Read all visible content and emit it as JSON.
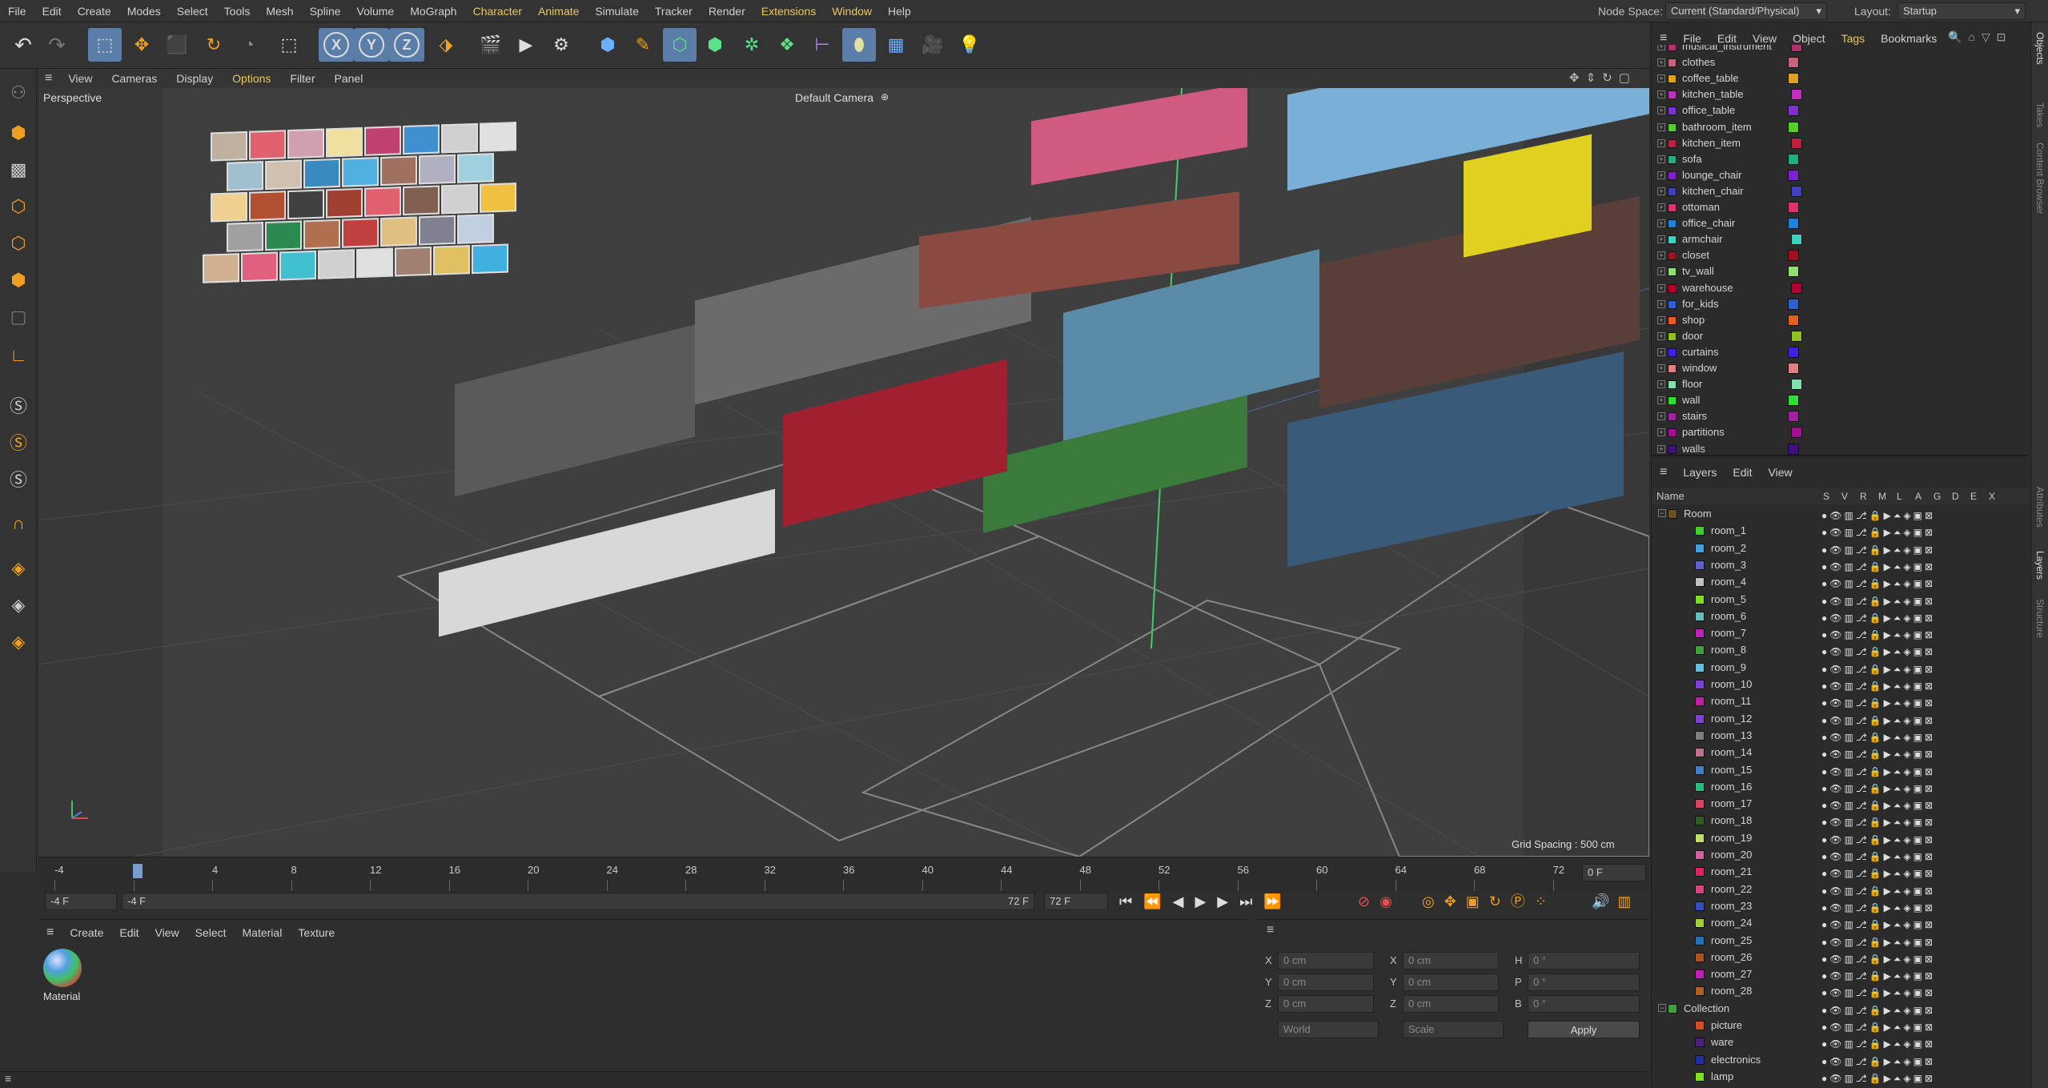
{
  "menubar": {
    "items": [
      "File",
      "Edit",
      "Create",
      "Modes",
      "Select",
      "Tools",
      "Mesh",
      "Spline",
      "Volume",
      "MoGraph",
      "Character",
      "Animate",
      "Simulate",
      "Tracker",
      "Render",
      "Extensions",
      "Window",
      "Help"
    ],
    "node_space_label": "Node Space:",
    "node_space_value": "Current (Standard/Physical)",
    "layout_label": "Layout:",
    "layout_value": "Startup"
  },
  "toolbar": {
    "axis_x": "X",
    "axis_y": "Y",
    "axis_z": "Z"
  },
  "viewport": {
    "menu": [
      "View",
      "Cameras",
      "Display",
      "Options",
      "Filter",
      "Panel"
    ],
    "view_name": "Perspective",
    "camera": "Default Camera",
    "grid_spacing": "Grid Spacing : 500 cm"
  },
  "timeline": {
    "ticks": [
      "-4",
      "0",
      "4",
      "8",
      "12",
      "16",
      "20",
      "24",
      "28",
      "32",
      "36",
      "40",
      "44",
      "48",
      "52",
      "56",
      "60",
      "64",
      "68",
      "72"
    ],
    "current_frame": "0 F",
    "start_field": "-4 F",
    "range_start": "-4 F",
    "range_end": "72 F",
    "end_field": "72 F"
  },
  "material_manager": {
    "menu": [
      "Create",
      "Edit",
      "View",
      "Select",
      "Material",
      "Texture"
    ],
    "material_name": "Material"
  },
  "attributes": {
    "x_label": "X",
    "y_label": "Y",
    "z_label": "Z",
    "h_label": "H",
    "p_label": "P",
    "b_label": "B",
    "pos_x": "0 cm",
    "pos_y": "0 cm",
    "pos_z": "0 cm",
    "size_x": "0 cm",
    "size_y": "0 cm",
    "size_z": "0 cm",
    "rot_h": "0 °",
    "rot_p": "0 °",
    "rot_b": "0 °",
    "coord_mode": "World",
    "size_mode": "Scale",
    "apply": "Apply"
  },
  "object_manager": {
    "menu": [
      "File",
      "Edit",
      "View",
      "Object",
      "Tags",
      "Bookmarks"
    ],
    "objects": [
      {
        "name": "musical_instrument",
        "color": "#b03070"
      },
      {
        "name": "clothes",
        "color": "#c86080"
      },
      {
        "name": "coffee_table",
        "color": "#e0a020"
      },
      {
        "name": "kitchen_table",
        "color": "#c030c0"
      },
      {
        "name": "office_table",
        "color": "#8030d0"
      },
      {
        "name": "bathroom_item",
        "color": "#50d020"
      },
      {
        "name": "kitchen_item",
        "color": "#c02040"
      },
      {
        "name": "sofa",
        "color": "#20b080"
      },
      {
        "name": "lounge_chair",
        "color": "#8020d0"
      },
      {
        "name": "kitchen_chair",
        "color": "#4040c0"
      },
      {
        "name": "ottoman",
        "color": "#e03070"
      },
      {
        "name": "office_chair",
        "color": "#2080e0"
      },
      {
        "name": "armchair",
        "color": "#40d0c0"
      },
      {
        "name": "closet",
        "color": "#a01020"
      },
      {
        "name": "tv_wall",
        "color": "#90e070"
      },
      {
        "name": "warehouse",
        "color": "#b00030"
      },
      {
        "name": "for_kids",
        "color": "#3060d0"
      },
      {
        "name": "shop",
        "color": "#e06020"
      },
      {
        "name": "door",
        "color": "#90c020"
      },
      {
        "name": "curtains",
        "color": "#4020e0"
      },
      {
        "name": "window",
        "color": "#e08080"
      },
      {
        "name": "floor",
        "color": "#80e0b0"
      },
      {
        "name": "wall",
        "color": "#30e030"
      },
      {
        "name": "stairs",
        "color": "#a020a0"
      },
      {
        "name": "partitions",
        "color": "#a01090"
      },
      {
        "name": "walls",
        "color": "#401080"
      }
    ]
  },
  "layers": {
    "menu": [
      "Layers",
      "Edit",
      "View"
    ],
    "col_name": "Name",
    "flag_headers": [
      "S",
      "V",
      "R",
      "M",
      "L",
      "A",
      "G",
      "D",
      "E",
      "X"
    ],
    "items": [
      {
        "name": "Room",
        "color": "#6a5020",
        "level": 0
      },
      {
        "name": "room_1",
        "color": "#40d020",
        "level": 1
      },
      {
        "name": "room_2",
        "color": "#40a0e0",
        "level": 1
      },
      {
        "name": "room_3",
        "color": "#6060d0",
        "level": 1
      },
      {
        "name": "room_4",
        "color": "#c0c0c0",
        "level": 1
      },
      {
        "name": "room_5",
        "color": "#80e020",
        "level": 1
      },
      {
        "name": "room_6",
        "color": "#60c0c0",
        "level": 1
      },
      {
        "name": "room_7",
        "color": "#c020c0",
        "level": 1
      },
      {
        "name": "room_8",
        "color": "#40a040",
        "level": 1
      },
      {
        "name": "room_9",
        "color": "#60c0e0",
        "level": 1
      },
      {
        "name": "room_10",
        "color": "#8040e0",
        "level": 1
      },
      {
        "name": "room_11",
        "color": "#c020a0",
        "level": 1
      },
      {
        "name": "room_12",
        "color": "#8040d0",
        "level": 1
      },
      {
        "name": "room_13",
        "color": "#808080",
        "level": 1
      },
      {
        "name": "room_14",
        "color": "#c07090",
        "level": 1
      },
      {
        "name": "room_15",
        "color": "#4080c0",
        "level": 1
      },
      {
        "name": "room_16",
        "color": "#20c080",
        "level": 1
      },
      {
        "name": "room_17",
        "color": "#e04060",
        "level": 1
      },
      {
        "name": "room_18",
        "color": "#306020",
        "level": 1
      },
      {
        "name": "room_19",
        "color": "#c0e060",
        "level": 1
      },
      {
        "name": "room_20",
        "color": "#d060a0",
        "level": 1
      },
      {
        "name": "room_21",
        "color": "#e02060",
        "level": 1
      },
      {
        "name": "room_22",
        "color": "#e04080",
        "level": 1
      },
      {
        "name": "room_23",
        "color": "#3050c0",
        "level": 1
      },
      {
        "name": "room_24",
        "color": "#a0d040",
        "level": 1
      },
      {
        "name": "room_25",
        "color": "#2070c0",
        "level": 1
      },
      {
        "name": "room_26",
        "color": "#b05020",
        "level": 1
      },
      {
        "name": "room_27",
        "color": "#c020c0",
        "level": 1
      },
      {
        "name": "room_28",
        "color": "#b06020",
        "level": 1
      },
      {
        "name": "Collection",
        "color": "#40a040",
        "level": 0
      },
      {
        "name": "picture",
        "color": "#d05020",
        "level": 1
      },
      {
        "name": "ware",
        "color": "#502080",
        "level": 1
      },
      {
        "name": "electronics",
        "color": "#2030a0",
        "level": 1
      },
      {
        "name": "lamp",
        "color": "#80e020",
        "level": 1
      }
    ]
  },
  "side_tabs": [
    "Objects",
    "Takes",
    "Content Browser",
    "Attributes",
    "Layers",
    "Structure"
  ]
}
